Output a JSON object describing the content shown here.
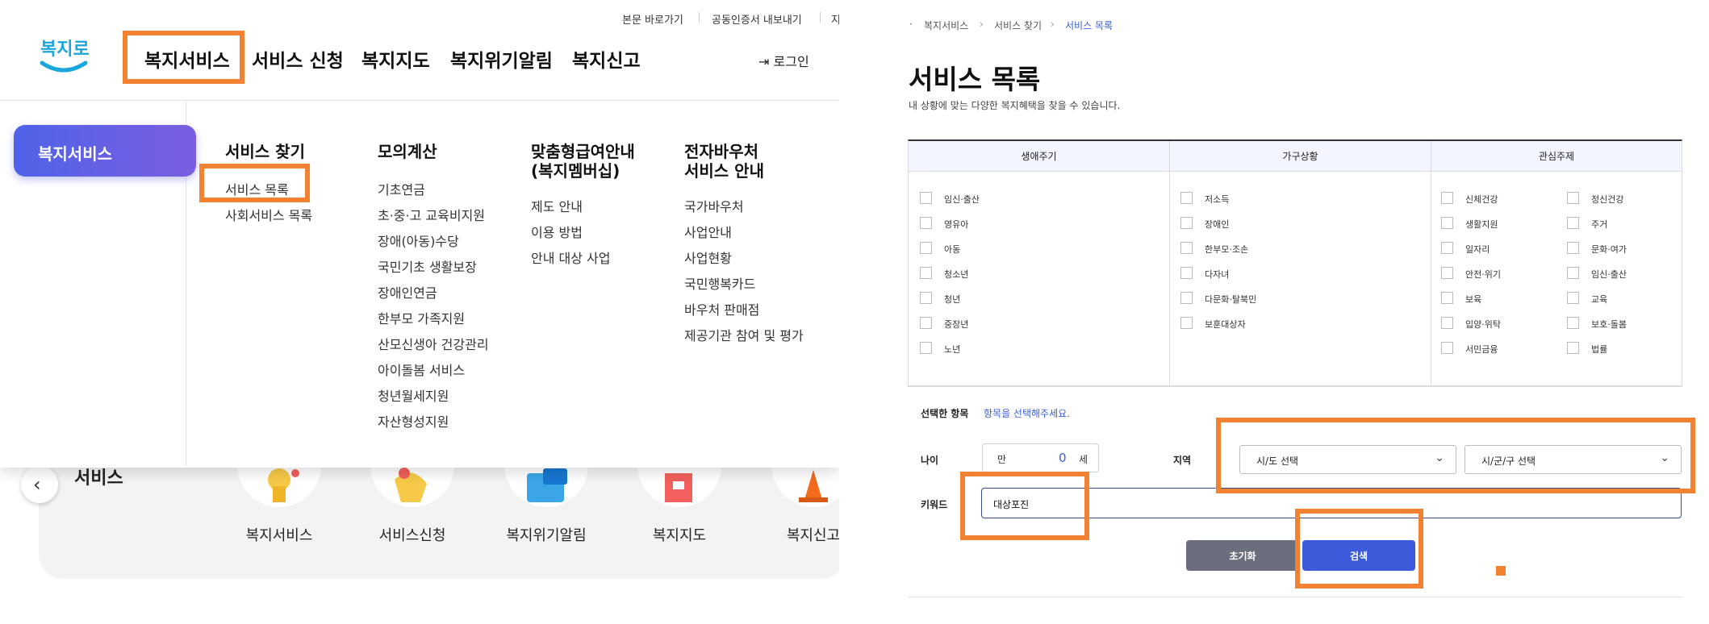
{
  "utility_links": [
    "본문 바로가기",
    "공동인증서 내보내기",
    "지"
  ],
  "logo_text": "복지로",
  "gnb": [
    "복지서비스",
    "서비스 신청",
    "복지지도",
    "복지위기알림",
    "복지신고"
  ],
  "login_label": "로그인",
  "mega_menu": {
    "active": "복지서비스",
    "columns": [
      {
        "title": "서비스 찾기",
        "items": [
          "서비스 목록",
          "사회서비스 목록"
        ]
      },
      {
        "title": "모의계산",
        "items": [
          "기초연금",
          "초·중·고 교육비지원",
          "장애(아동)수당",
          "국민기초 생활보장",
          "장애인연금",
          "한부모 가족지원",
          "산모신생아 건강관리",
          "아이돌봄 서비스",
          "청년월세지원",
          "자산형성지원"
        ]
      },
      {
        "title_lines": [
          "맞춤형급여안내",
          "(복지멤버십)"
        ],
        "items": [
          "제도 안내",
          "이용 방법",
          "안내 대상 사업"
        ]
      },
      {
        "title_lines": [
          "전자바우처",
          "서비스 안내"
        ],
        "items": [
          "국가바우처",
          "사업안내",
          "사업현황",
          "국민행복카드",
          "바우처 판매점",
          "제공기관 참여 및 평가"
        ]
      }
    ]
  },
  "services_section": {
    "title": "서비스",
    "items": [
      "복지서비스",
      "서비스신청",
      "복지위기알림",
      "복지지도",
      "복지신고"
    ]
  },
  "breadcrumb": [
    "복지서비스",
    "서비스 찾기",
    "서비스 목록"
  ],
  "page": {
    "title": "서비스 목록",
    "subtitle": "내 상황에 맞는 다양한 복지혜택을 찾을 수 있습니다."
  },
  "filter": {
    "headers": [
      "생애주기",
      "가구상황",
      "관심주제"
    ],
    "life_cycle": [
      "임신·출산",
      "영유아",
      "아동",
      "청소년",
      "청년",
      "중장년",
      "노년"
    ],
    "household": [
      "저소득",
      "장애인",
      "한부모·조손",
      "다자녀",
      "다문화·탈북민",
      "보훈대상자"
    ],
    "interest_left": [
      "신체건강",
      "생활지원",
      "일자리",
      "안전·위기",
      "보육",
      "입양·위탁",
      "서민금융"
    ],
    "interest_right": [
      "정신건강",
      "주거",
      "문화·여가",
      "임신·출산",
      "교육",
      "보호·돌봄",
      "법률"
    ]
  },
  "form": {
    "selected_label": "선택한 항목",
    "selected_hint": "항목을 선택해주세요.",
    "age_label": "나이",
    "age_prefix": "만",
    "age_value": "0",
    "age_suffix": "세",
    "region_label": "지역",
    "sido_select": "시/도 선택",
    "sigungu_select": "시/군/구 선택",
    "keyword_label": "키워드",
    "keyword_value": "대상포진",
    "reset_label": "초기화",
    "search_label": "검색"
  },
  "colors": {
    "highlight": "#f28232",
    "primary_button": "#3b5bdb",
    "reset_button": "#6b6f7d",
    "pill_start": "#4f63e8",
    "pill_end": "#7c5ee0",
    "link_blue": "#3b5fd6"
  }
}
